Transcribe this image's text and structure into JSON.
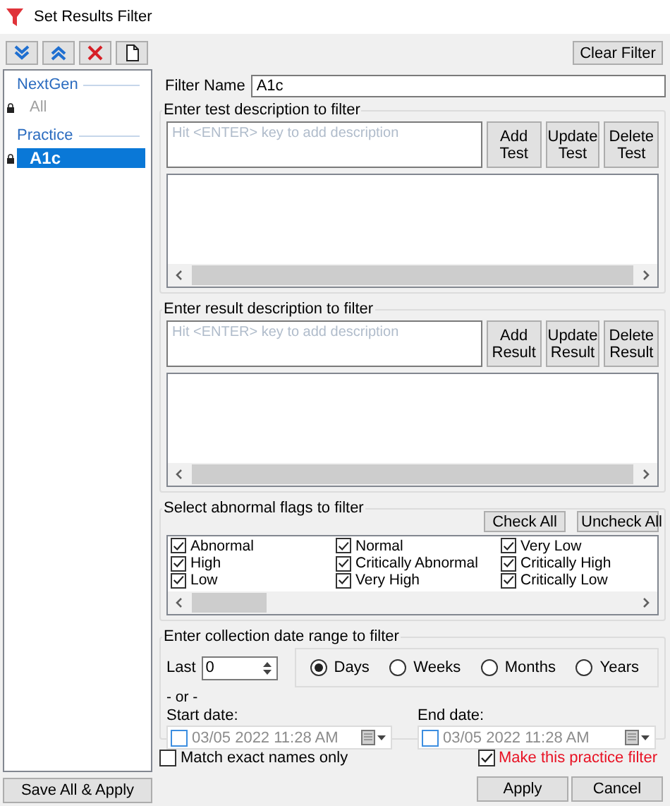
{
  "window": {
    "title": "Set Results Filter"
  },
  "sidebar": {
    "groups": [
      {
        "label": "NextGen",
        "items": [
          {
            "label": "All",
            "selected": false,
            "disabled": true
          }
        ]
      },
      {
        "label": "Practice",
        "items": [
          {
            "label": "A1c",
            "selected": true,
            "disabled": false
          }
        ]
      }
    ],
    "save_button": "Save All & Apply"
  },
  "clear_button": "Clear Filter",
  "filter_name": {
    "label": "Filter Name",
    "value": "A1c"
  },
  "test_group": {
    "title": "Enter test description to filter",
    "placeholder": "Hit <ENTER> key to add description",
    "buttons": [
      "Add Test",
      "Update Test",
      "Delete Test"
    ]
  },
  "result_group": {
    "title": "Enter result description to filter",
    "placeholder": "Hit <ENTER> key to add description",
    "buttons": [
      "Add Result",
      "Update Result",
      "Delete Result"
    ]
  },
  "flags": {
    "title": "Select abnormal flags to filter",
    "buttons": [
      "Check All",
      "Uncheck All"
    ],
    "items": [
      {
        "label": "Abnormal",
        "checked": true
      },
      {
        "label": "Normal",
        "checked": true
      },
      {
        "label": "Very Low",
        "checked": true
      },
      {
        "label": "High",
        "checked": true
      },
      {
        "label": "Critically Abnormal",
        "checked": true
      },
      {
        "label": "Critically High",
        "checked": true
      },
      {
        "label": "Low",
        "checked": true
      },
      {
        "label": "Very High",
        "checked": true
      },
      {
        "label": "Critically Low",
        "checked": true
      }
    ]
  },
  "date_range": {
    "title": "Enter collection date range to filter",
    "last_label": "Last",
    "last_value": "0",
    "units": [
      {
        "label": "Days",
        "selected": true
      },
      {
        "label": "Weeks",
        "selected": false
      },
      {
        "label": "Months",
        "selected": false
      },
      {
        "label": "Years",
        "selected": false
      }
    ],
    "or_label": "- or -",
    "start": {
      "label": "Start date:",
      "value": "03/05 2022 11:28 AM",
      "checked": false
    },
    "end": {
      "label": "End date:",
      "value": "03/05 2022 11:28 AM",
      "checked": false
    }
  },
  "match_exact": {
    "label": "Match exact names only",
    "checked": false
  },
  "practice_filter": {
    "label": "Make this practice filter",
    "checked": true
  },
  "buttons": [
    "Apply",
    "Cancel"
  ]
}
